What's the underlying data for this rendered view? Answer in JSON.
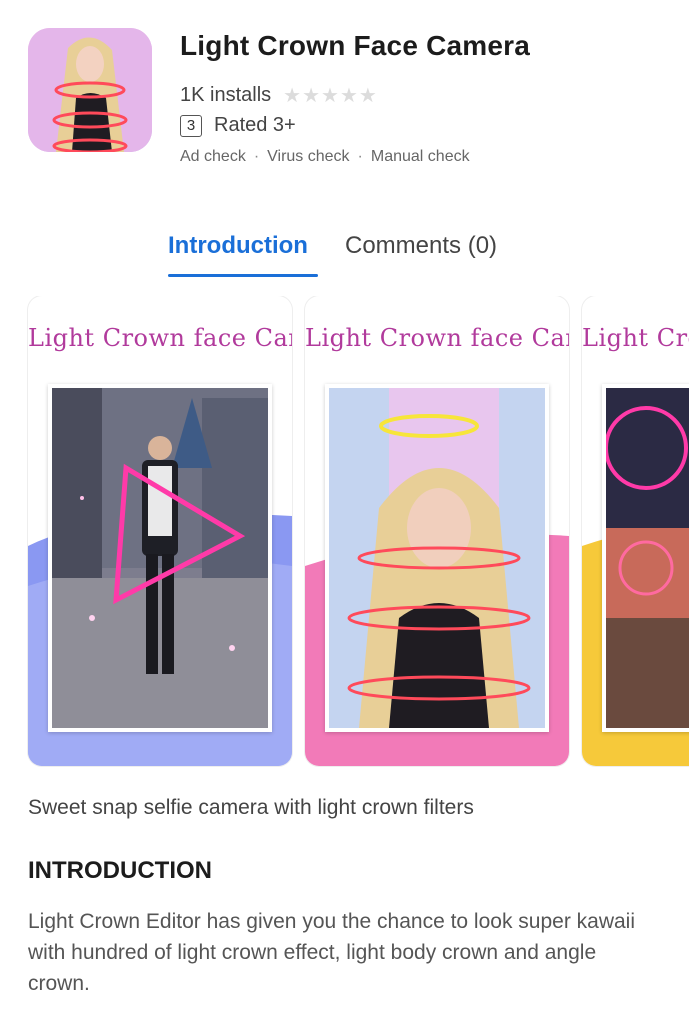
{
  "app": {
    "title": "Light Crown Face Camera",
    "installs": "1K installs",
    "stars": "★★★★★",
    "age_rating_badge": "3",
    "age_rating_text": "Rated 3+",
    "checks": [
      "Ad check",
      "Virus check",
      "Manual check"
    ],
    "check_separator": "·"
  },
  "tabs": [
    {
      "label": "Introduction",
      "active": true
    },
    {
      "label": "Comments (0)",
      "active": false
    }
  ],
  "screenshots": [
    {
      "title": "Light Crown face Camera",
      "accent": "#7f8ff0"
    },
    {
      "title": "Light Crown face Camera",
      "accent": "#f07ab6"
    },
    {
      "title": "Light Crown face Camera",
      "accent": "#f6c93a"
    }
  ],
  "description": "Sweet snap selfie camera with light crown filters",
  "introduction": {
    "heading": "INTRODUCTION",
    "body": "Light Crown Editor has given you the chance to look super kawaii with hundred of light crown effect, light body crown and angle crown."
  },
  "colors": {
    "accent_blue": "#1a6fd8",
    "neon_pink": "#ff3aa8",
    "neon_red": "#ff4a5a",
    "halo_yellow": "#f7e53a"
  }
}
